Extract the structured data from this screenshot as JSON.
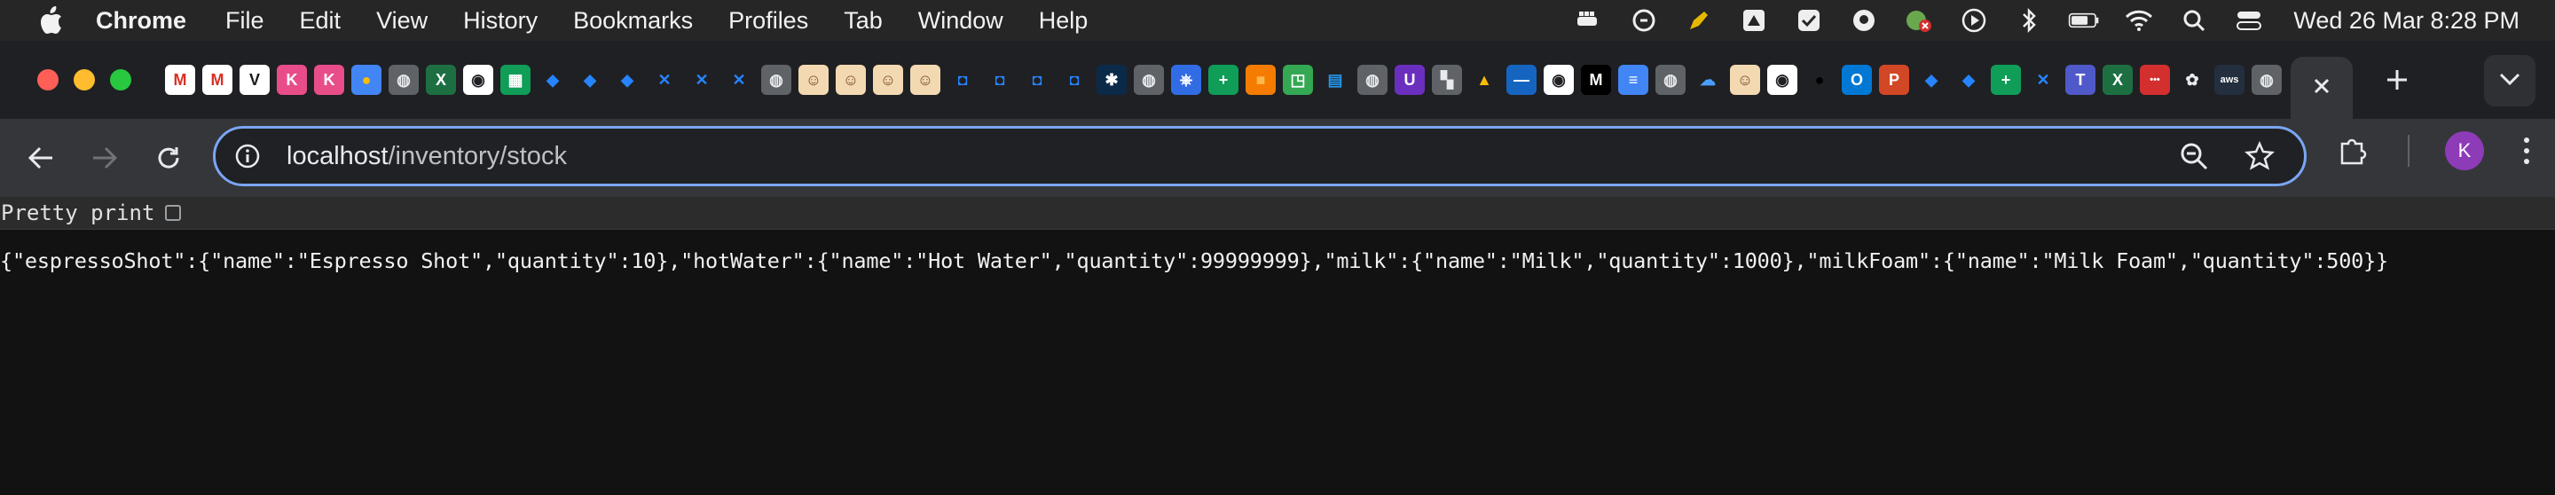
{
  "menubar": {
    "app_name": "Chrome",
    "items": [
      "File",
      "Edit",
      "View",
      "History",
      "Bookmarks",
      "Profiles",
      "Tab",
      "Window",
      "Help"
    ],
    "clock": "Wed 26 Mar  8:28 PM"
  },
  "tabs": {
    "pinned_favicons": [
      "gmail-icon",
      "gmail-icon",
      "v-icon",
      "klipfolio-icon",
      "klipfolio-icon",
      "colorful-icon",
      "globe-icon",
      "excel-icon",
      "github-icon",
      "sheets-icon",
      "jira-icon",
      "jira-icon",
      "jira-icon",
      "confluence-icon",
      "confluence-icon",
      "confluence-icon",
      "globe-icon",
      "jenkins-icon",
      "jenkins-icon",
      "jenkins-icon",
      "jenkins-icon",
      "bitbucket-icon",
      "bitbucket-icon",
      "bitbucket-icon",
      "bitbucket-icon",
      "snowflake-icon",
      "globe-icon",
      "kubernetes-icon",
      "plus-icon",
      "orange-cube-icon",
      "green-icon",
      "docker-icon",
      "globe-icon",
      "purple-icon",
      "gray-icon",
      "drive-icon",
      "minus-icon",
      "github-icon",
      "mc-icon",
      "docs-icon",
      "globe-icon",
      "cloud-icon",
      "jenkins-icon",
      "github-icon",
      "dark-icon",
      "outlook-icon",
      "powerpoint-icon",
      "jira-icon",
      "jira-icon",
      "plus-icon",
      "confluence-icon",
      "teams-icon",
      "excel-icon",
      "dots-icon",
      "openai-icon",
      "aws-icon",
      "globe-icon"
    ]
  },
  "toolbar": {
    "url_host": "localhost",
    "url_path": "/inventory/stock",
    "avatar_letter": "K"
  },
  "page": {
    "pretty_print_label": "Pretty print",
    "json_text": "{\"espressoShot\":{\"name\":\"Espresso Shot\",\"quantity\":10},\"hotWater\":{\"name\":\"Hot Water\",\"quantity\":99999999},\"milk\":{\"name\":\"Milk\",\"quantity\":1000},\"milkFoam\":{\"name\":\"Milk Foam\",\"quantity\":500}}"
  },
  "colors": {
    "accent": "#7aa6f4",
    "avatar": "#8e3bb8",
    "page_bg": "#121212"
  }
}
